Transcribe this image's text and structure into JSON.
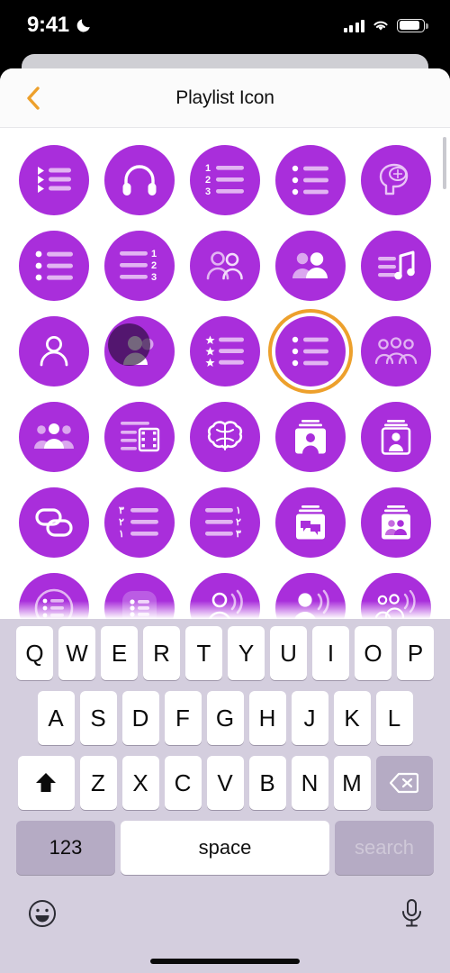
{
  "statusbar": {
    "time": "9:41",
    "moon_icon": "crescent-moon-icon",
    "signal_icon": "cellular-signal-icon",
    "wifi_icon": "wifi-icon",
    "battery_icon": "battery-icon"
  },
  "navbar": {
    "title": "Playlist Icon",
    "back_icon": "back-chevron-icon",
    "back_color": "#eda02c"
  },
  "theme": {
    "bubble_purple": "#a92edb",
    "selection_ring": "#eda02c",
    "keyboard_bg": "#d4cede",
    "key_white": "#ffffff",
    "key_gray": "#b5abc4"
  },
  "grid": {
    "selected_index": 13,
    "pressed_index": 11,
    "icons": [
      {
        "index": 0,
        "name": "playlist-triangle-bullets-icon"
      },
      {
        "index": 1,
        "name": "headphones-icon"
      },
      {
        "index": 2,
        "name": "numbered-list-123-left-icon"
      },
      {
        "index": 3,
        "name": "bulleted-list-icon"
      },
      {
        "index": 4,
        "name": "head-brain-music-icon"
      },
      {
        "index": 5,
        "name": "bulleted-list-dots-icon"
      },
      {
        "index": 6,
        "name": "numbered-list-123-right-icon"
      },
      {
        "index": 7,
        "name": "two-people-outline-icon"
      },
      {
        "index": 8,
        "name": "two-people-filled-icon"
      },
      {
        "index": 9,
        "name": "list-music-note-icon"
      },
      {
        "index": 10,
        "name": "single-person-outline-icon"
      },
      {
        "index": 11,
        "name": "person-pressed-icon"
      },
      {
        "index": 12,
        "name": "star-bullet-list-icon"
      },
      {
        "index": 13,
        "name": "bulleted-list-selected-icon"
      },
      {
        "index": 14,
        "name": "three-people-outline-icon"
      },
      {
        "index": 15,
        "name": "three-people-filled-icon"
      },
      {
        "index": 16,
        "name": "list-film-strip-icon"
      },
      {
        "index": 17,
        "name": "brain-icon"
      },
      {
        "index": 18,
        "name": "card-person-portrait-icon"
      },
      {
        "index": 19,
        "name": "card-person-bust-icon"
      },
      {
        "index": 20,
        "name": "chain-link-icon"
      },
      {
        "index": 21,
        "name": "arabic-numbered-list-left-icon"
      },
      {
        "index": 22,
        "name": "arabic-numbered-list-right-icon"
      },
      {
        "index": 23,
        "name": "card-speech-bubbles-icon"
      },
      {
        "index": 24,
        "name": "card-two-people-icon"
      },
      {
        "index": 25,
        "name": "circled-list-icon"
      },
      {
        "index": 26,
        "name": "rounded-square-list-icon"
      },
      {
        "index": 27,
        "name": "person-broadcast-outline-icon"
      },
      {
        "index": 28,
        "name": "person-broadcast-filled-icon"
      },
      {
        "index": 29,
        "name": "group-broadcast-icon"
      }
    ]
  },
  "keyboard": {
    "row1": [
      "Q",
      "W",
      "E",
      "R",
      "T",
      "Y",
      "U",
      "I",
      "O",
      "P"
    ],
    "row2": [
      "A",
      "S",
      "D",
      "F",
      "G",
      "H",
      "J",
      "K",
      "L"
    ],
    "row3_letters": [
      "Z",
      "X",
      "C",
      "V",
      "B",
      "N",
      "M"
    ],
    "shift_icon": "shift-up-arrow-icon",
    "backspace_icon": "backspace-delete-icon",
    "numeric_label": "123",
    "space_label": "space",
    "return_label": "search",
    "emoji_icon": "emoji-smiley-icon",
    "dictation_icon": "microphone-icon",
    "home_indicator": "home-indicator-bar"
  }
}
